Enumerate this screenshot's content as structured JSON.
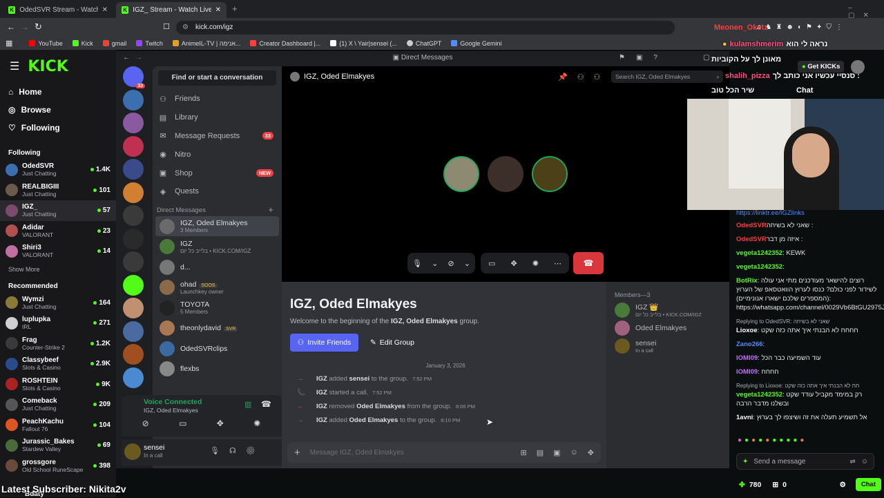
{
  "browser": {
    "tabs": [
      {
        "title": "OdedSVR Stream - Watch Live on Kic",
        "active": false
      },
      {
        "title": "IGZ_ Stream - Watch Live on Kick",
        "active": true
      }
    ],
    "url": "kick.com/igz",
    "bookmarks": [
      {
        "label": "YouTube",
        "color": "#ff0000"
      },
      {
        "label": "Kick",
        "color": "#53fc18"
      },
      {
        "label": "gmail",
        "color": "#ea4335"
      },
      {
        "label": "Twitch",
        "color": "#9146ff"
      },
      {
        "label": "AnimeIL-TV | אנימה...",
        "color": "#e0a030"
      },
      {
        "label": "Creator Dashboard |...",
        "color": "#ff4040"
      },
      {
        "label": "(1) X \\ Yair|sensei (...",
        "color": "#ffffff"
      },
      {
        "label": "ChatGPT",
        "color": "#cccccc"
      },
      {
        "label": "Google Gemini",
        "color": "#4e8cff"
      }
    ]
  },
  "kick": {
    "logo": "KICK",
    "nav": [
      {
        "label": "Home",
        "icon": "home-icon"
      },
      {
        "label": "Browse",
        "icon": "compass-icon"
      },
      {
        "label": "Following",
        "icon": "heart-icon"
      }
    ],
    "following_title": "Following",
    "following": [
      {
        "name": "OdedSVR",
        "category": "Just Chatting",
        "viewers": "1.4K",
        "color": "#3b6fb0"
      },
      {
        "name": "REALBIGIII",
        "category": "Just Chatting",
        "viewers": "101",
        "color": "#6b5b4b"
      },
      {
        "name": "IGZ_",
        "category": "Just Chatting",
        "viewers": "57",
        "color": "#7a4b6b"
      },
      {
        "name": "Adidar",
        "category": "VALORANT",
        "viewers": "23",
        "color": "#b05050"
      },
      {
        "name": "Shiri3",
        "category": "VALORANT",
        "viewers": "14",
        "color": "#c070a0"
      }
    ],
    "show_more": "Show More",
    "recommended_title": "Recommended",
    "recommended": [
      {
        "name": "Wymzi",
        "category": "Just Chatting",
        "viewers": "164",
        "color": "#8a7a3a"
      },
      {
        "name": "luplupka",
        "category": "IRL",
        "viewers": "271",
        "color": "#d0d0d0"
      },
      {
        "name": "Frag",
        "category": "Counter-Strike 2",
        "viewers": "1.2K",
        "color": "#3a3a3a"
      },
      {
        "name": "Classybeef",
        "category": "Slots & Casino",
        "viewers": "2.9K",
        "color": "#2a4a8a"
      },
      {
        "name": "ROSHTEIN",
        "category": "Slots & Casino",
        "viewers": "9K",
        "color": "#aa2222"
      },
      {
        "name": "Comeback",
        "category": "Just Chatting",
        "viewers": "209",
        "color": "#555555"
      },
      {
        "name": "PeachKachu",
        "category": "Fallout 76",
        "viewers": "104",
        "color": "#dd5522"
      },
      {
        "name": "Jurassic_Bakes",
        "category": "Stardew Valley",
        "viewers": "69",
        "color": "#4a6a3a"
      },
      {
        "name": "grossgore",
        "category": "Old School RuneScape",
        "viewers": "398",
        "color": "#6a4a3a"
      }
    ],
    "bottom_partial": "Bdaty",
    "latest_sub": "Latest Subscriber: Nikita2v"
  },
  "discord": {
    "title": "Direct Messages",
    "server_badge": "33",
    "find": "Find or start a conversation",
    "menu": [
      {
        "label": "Friends",
        "badge": ""
      },
      {
        "label": "Library",
        "badge": ""
      },
      {
        "label": "Message Requests",
        "badge": "33"
      },
      {
        "label": "Nitro",
        "badge": ""
      },
      {
        "label": "Shop",
        "badge": "NEW"
      },
      {
        "label": "Quests",
        "badge": ""
      }
    ],
    "dm_header": "Direct Messages",
    "dms": [
      {
        "name": "IGZ, Oded Elmakyes",
        "sub": "3 Members",
        "color": "#6a6a6a"
      },
      {
        "name": "IGZ",
        "sub": "בלייב כל יום • KICK.COM/IGZ",
        "color": "#4a7a3a"
      },
      {
        "name": "d...",
        "sub": "",
        "color": "#777777"
      },
      {
        "name": "ohad",
        "tag": "SOOS",
        "sub": "Launchkey owner",
        "color": "#8a6a4a"
      },
      {
        "name": "TOYOTA",
        "sub": "5 Members",
        "color": "#222222"
      },
      {
        "name": "theonlydavid",
        "tag": "SVR",
        "sub": "",
        "color": "#aa7755"
      },
      {
        "name": "OdedSVRclips",
        "sub": "",
        "color": "#3a6aa0"
      },
      {
        "name": "flexbs",
        "sub": "",
        "color": "#888888"
      }
    ],
    "voice": {
      "status": "Voice Connected",
      "channel": "IGZ, Oded Elmakyes"
    },
    "user": {
      "name": "sensei",
      "status": "In a call"
    },
    "call_header": "IGZ, Oded Elmakyes",
    "search_placeholder": "Search IGZ, Oded Elmakyes",
    "group_title": "IGZ, Oded Elmakyes",
    "welcome_prefix": "Welcome to the beginning of the ",
    "welcome_group": "IGZ, Oded Elmakyes",
    "welcome_suffix": " group.",
    "invite_label": "Invite Friends",
    "edit_label": "Edit Group",
    "date": "January 3, 2026",
    "events": [
      {
        "arrow": "→",
        "color": "#23a55a",
        "actor": "IGZ",
        "action": " added ",
        "target": "sensei",
        "rest": " to the group.",
        "time": "7:52 PM"
      },
      {
        "arrow": "📞",
        "color": "#23a55a",
        "actor": "IGZ",
        "action": " started a call.",
        "target": "",
        "rest": "",
        "time": "7:52 PM"
      },
      {
        "arrow": "←",
        "color": "#f23f43",
        "actor": "IGZ",
        "action": " removed ",
        "target": "Oded Elmakyes",
        "rest": " from the group.",
        "time": "8:06 PM"
      },
      {
        "arrow": "→",
        "color": "#23a55a",
        "actor": "IGZ",
        "action": " added ",
        "target": "Oded Elmakyes",
        "rest": " to the group.",
        "time": "8:10 PM"
      }
    ],
    "message_placeholder": "Message IGZ, Oded Elmakyes",
    "members_title": "Members—3",
    "members": [
      {
        "name": "IGZ 👑",
        "sub": "בלייב כל יום • KICK.COM/IGZ",
        "color": "#4a7a3a"
      },
      {
        "name": "Oded Elmakyes",
        "sub": "",
        "color": "#a06080"
      },
      {
        "name": "sensei",
        "sub": "In a call",
        "color": "#6a5a20"
      }
    ]
  },
  "chat": {
    "overlay_top": "Meonen_Oketz",
    "overlay_line2_user": "kulamshmerim",
    "overlay_line2_msg": "נראה לי הוא",
    "overlay_line3": "מאונן לך על הקוביות",
    "get_kicks": "Get KICKs",
    "overlay_line4_user": "shalih_pizza",
    "overlay_line4_msg": "סנסיי עכשיו אני כותב לך :",
    "overlay_line5": "שיר הכל טוב",
    "chat_title": "Chat",
    "link": "https://linktr.ee/IGZlinks",
    "messages": [
      {
        "user": "OdedSVR",
        "color": "#ff3b3b",
        "text": "שאני לא בשיחה :"
      },
      {
        "user": "OdedSVR",
        "color": "#ff3b3b",
        "text": "איזה מן דבר :"
      },
      {
        "user": "vegeta1242352",
        "color": "#53fc18",
        "text": ": KEWK"
      },
      {
        "user": "vegeta1242352",
        "color": "#53fc18",
        "text": ":"
      },
      {
        "user": "BotRix",
        "color": "#53fc18",
        "text": ": רוצים להישאר מעודכנים מתי אני עולה לשידור לפני כולם? כנסו לערוץ הוואטסאפ של הערוץ (המספרים שלכם ישארו אנונימיים): https://whatsapp.com/channel/0029Vb6BtGU2975J0Dtb4X3b"
      },
      {
        "reply": "Replying to OdedSVR: שאני לא בשיחה",
        "user": "Lioxoe",
        "color": "#ffffff",
        "text": ": חחחח לא הבנתי איך אתה כזה שקט"
      },
      {
        "user": "Zano266",
        "color": "#4e8cff",
        "text": ":"
      },
      {
        "user": "IOMI09",
        "color": "#c070ff",
        "text": ": עוד השמיעה כבר הכל"
      },
      {
        "user": "IOMI09",
        "color": "#c070ff",
        "text": ": חחחח"
      },
      {
        "reply": "Replying to Lioxoe: חח לא הבנתי איך אתה כזה שקט",
        "user": "vegeta1242352",
        "color": "#53fc18",
        "text": ": רק במימד מקביל עודד שקט ובשלנו מדבר הרבה"
      },
      {
        "user": "1avni",
        "color": "#ffffff",
        "text": ": אל תשמיע תעלה את זה ושיצפו לך בערוץ"
      }
    ],
    "send_placeholder": "Send a message",
    "points": "780",
    "gifts": "0",
    "chat_button": "Chat"
  }
}
